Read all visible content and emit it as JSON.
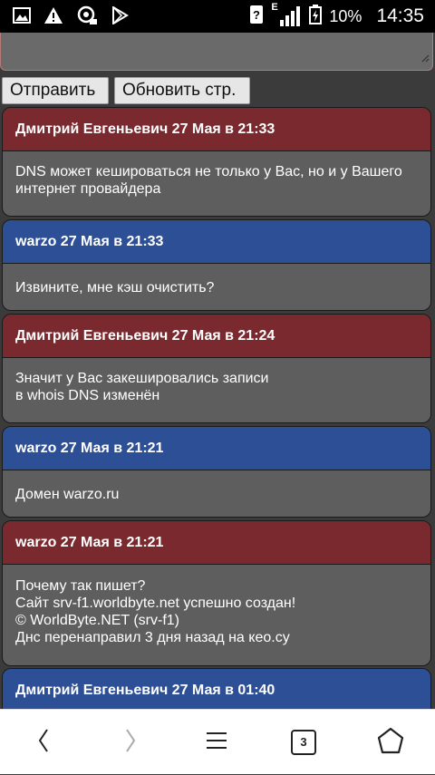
{
  "status_bar": {
    "left_icons": [
      "image-icon",
      "warning-icon",
      "media-icon",
      "play-store-icon"
    ],
    "right_icons": [
      "nfc-icon",
      "signal-icon",
      "battery-icon"
    ],
    "network_label": "E",
    "battery": "10%",
    "time": "14:35"
  },
  "form": {
    "send_label": "Отправить",
    "refresh_label": "Обновить стр."
  },
  "messages": [
    {
      "header": "Дмитрий Евгеньевич 27 Мая в 21:33",
      "color": "#7a2a2e",
      "lines": [
        "DNS может кешироваться не только у Вас, но и у Вашего",
        "интернет провайдера"
      ]
    },
    {
      "header": "warzo 27 Мая в 21:33",
      "color": "#2d4f96",
      "lines": [
        "Извините, мне кэш очистить?"
      ]
    },
    {
      "header": "Дмитрий Евгеньевич 27 Мая в 21:24",
      "color": "#7a2a2e",
      "lines": [
        "Значит у Вас закешировались записи",
        "в whois DNS изменён"
      ]
    },
    {
      "header": "warzo 27 Мая в 21:21",
      "color": "#2d4f96",
      "lines": [
        "Домен warzo.ru"
      ]
    },
    {
      "header": "warzo 27 Мая в 21:21",
      "color": "#7a2a2e",
      "lines": [
        "Почему так пишет?",
        "Сайт srv-f1.worldbyte.net успешно создан!",
        "© WorldByte.NET (srv-f1)",
        "Днс перенаправил 3 дня назад на кео.су"
      ]
    },
    {
      "header": "Дмитрий Евгеньевич 27 Мая в 01:40",
      "color": "#2d4f96",
      "lines": []
    }
  ],
  "nav_bar": {
    "tabs_count": "3",
    "icons": [
      "back-icon",
      "forward-icon",
      "menu-icon",
      "tabs-icon",
      "home-icon"
    ]
  }
}
